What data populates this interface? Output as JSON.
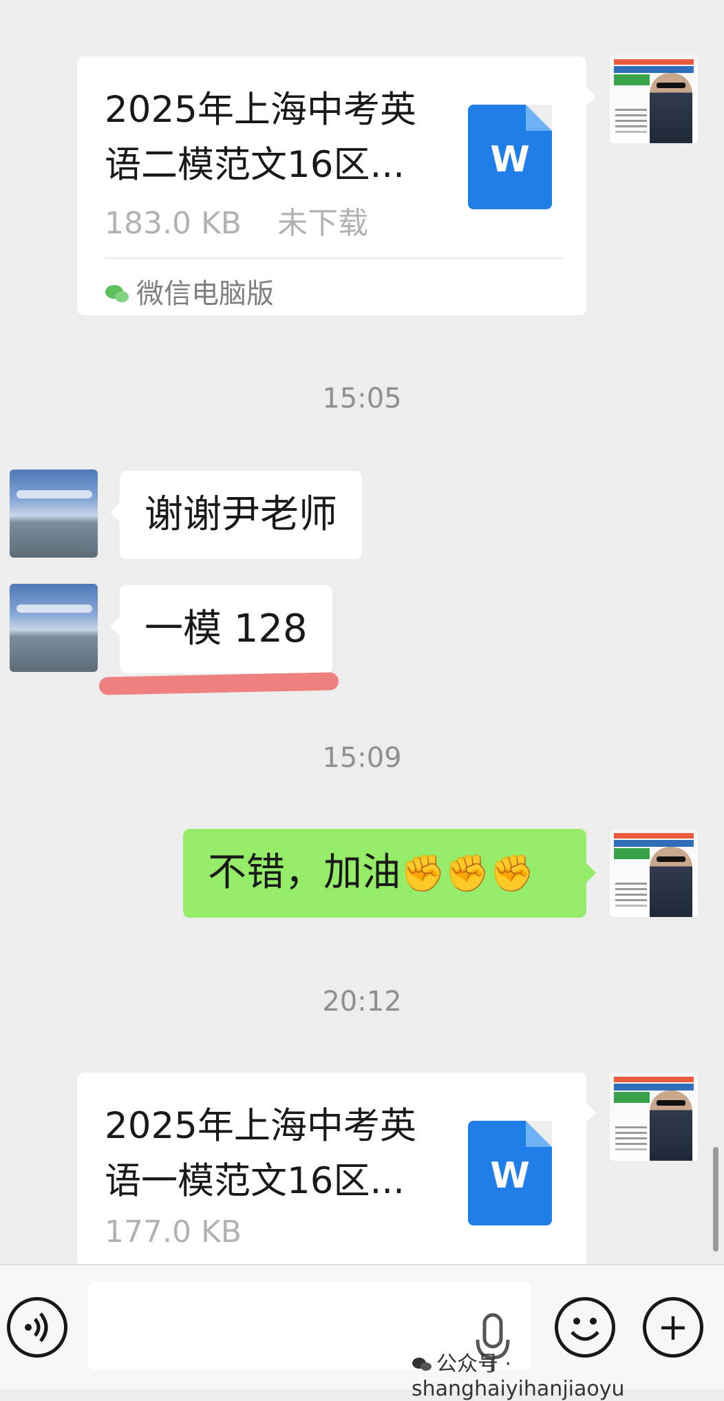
{
  "messages": {
    "file1": {
      "title_line1": "2025年上海中考英",
      "title_line2": "语二模范文16区...",
      "size": "183.0 KB",
      "status": "未下载",
      "source": "微信电脑版",
      "icon": "word-doc-icon",
      "icon_letter": "W"
    },
    "time1": "15:05",
    "received1": "谢谢尹老师",
    "received2": "一模 128",
    "time2": "15:09",
    "sent1": "不错，加油",
    "sent1_emoji": "✊✊✊",
    "time3": "20:12",
    "file2": {
      "title_line1": "2025年上海中考英",
      "title_line2": "语一模范文16区...",
      "size": "177.0 KB",
      "icon": "word-doc-icon",
      "icon_letter": "W"
    }
  },
  "input_bar": {
    "voice_icon": "voice-icon",
    "mic_icon": "mic-icon",
    "emoji_icon": "smiley-icon",
    "plus_icon": "plus-icon",
    "plus_glyph": "+"
  },
  "watermark": "公众号 · shanghaiyihanjiaoyu",
  "colors": {
    "background": "#ededed",
    "sent_bubble": "#95ec69",
    "received_bubble": "#ffffff",
    "word_icon": "#1f7ee8",
    "underline": "#ee6c6c"
  }
}
